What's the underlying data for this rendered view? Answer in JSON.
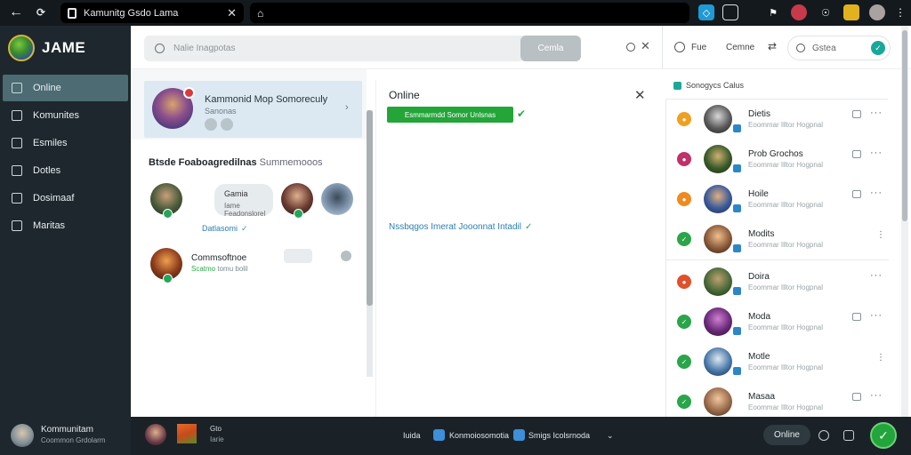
{
  "browser": {
    "tab_title": "Kamunitg Gsdo Lama",
    "back_icon": "arrow-left-icon",
    "reload_icon": "reload-icon",
    "home_icon": "home-icon"
  },
  "brand": {
    "name": "JAME"
  },
  "sidebar": {
    "items": [
      {
        "label": "Online",
        "icon": "user-icon",
        "active": true
      },
      {
        "label": "Komunites",
        "icon": "community-icon",
        "active": false
      },
      {
        "label": "Esmiles",
        "icon": "friends-icon",
        "active": false
      },
      {
        "label": "Dotles",
        "icon": "chat-icon",
        "active": false
      },
      {
        "label": "Dosimaaf",
        "icon": "calendar-icon",
        "active": false
      },
      {
        "label": "Maritas",
        "icon": "list-icon",
        "active": false
      }
    ]
  },
  "search": {
    "placeholder": "Nalie Inagpotas",
    "button": "Cemla"
  },
  "header_right": {
    "label1": "Fue",
    "label2": "Cemne",
    "search_placeholder": "Gstea"
  },
  "group_card": {
    "title": "Kammonid Mop Somoreculy",
    "subtitle": "Sanonas"
  },
  "friends_panel": {
    "title_bold": "Btsde Foaboagredilnas",
    "title_light": "Summemooos",
    "bubble_name": "Gamia",
    "bubble_text": "Iame Feadonslorel",
    "link": "Datlasomi",
    "friend2_name": "Commsoftnoe",
    "friend2_status": "Scatmo",
    "friend2_sub": "tomu bolil"
  },
  "online_panel": {
    "title": "Online",
    "tag": "Esmmarmdd Somor Unlsnas",
    "note": "Nssbqgos Imerat Jooonnat Intadil"
  },
  "contact_list": {
    "header": "Sonogycs Calus",
    "contacts": [
      {
        "name": "Dietis",
        "sub": "Eoommar Illtor Hogpnal",
        "status_color": "#f0a020"
      },
      {
        "name": "Prob Grochos",
        "sub": "Eoommar Illtor Hogpnal",
        "status_color": "#c0306a"
      },
      {
        "name": "Hoile",
        "sub": "Eoommar Illtor Hogpnal",
        "status_color": "#f08a1e"
      },
      {
        "name": "Modits",
        "sub": "Eoommar Illtor Hogpnal",
        "status_color": "#2aa54a"
      },
      {
        "name": "Doira",
        "sub": "Eoommar Illtor Hogpnal",
        "status_color": "#e0502a"
      },
      {
        "name": "Moda",
        "sub": "Eoommar Illtor Hogpnal",
        "status_color": "#2aa54a"
      },
      {
        "name": "Motle",
        "sub": "Eoommar Illtor Hogpnal",
        "status_color": "#2aa54a"
      },
      {
        "name": "Masaa",
        "sub": "Eoommar Illtor Hogpnal",
        "status_color": "#2aa54a"
      }
    ]
  },
  "bottombar": {
    "user_name": "Kommunitam",
    "user_sub": "Coommon Grdolarm",
    "mini1": "Gto",
    "mini2": "Iarie",
    "label_a": "Iuida",
    "label_b": "Konmoiosomotia",
    "label_c": "Smigs Icolsrnoda",
    "online_button": "Online"
  }
}
